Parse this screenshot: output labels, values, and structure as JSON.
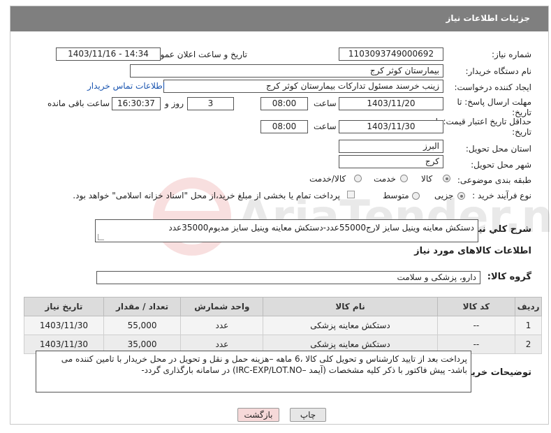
{
  "header": {
    "title": "جزئیات اطلاعات نیاز"
  },
  "labels": {
    "need_number": "شماره نیاز:",
    "announce_datetime": "تاریخ و ساعت اعلان عمومی:",
    "buyer_org": "نام دستگاه خریدار:",
    "requester": "ایجاد کننده درخواست:",
    "contact_link": "اطلاعات تماس خریدار",
    "reply_deadline_1": "مهلت ارسال پاسخ: تا",
    "reply_deadline_2": "تاریخ:",
    "time": "ساعت",
    "day_and": "روز و",
    "hours_remaining": "ساعت باقی مانده",
    "price_validity_1": "حداقل تاریخ اعتبار قیمت: تا",
    "price_validity_2": "تاریخ:",
    "delivery_province": "استان محل تحویل:",
    "delivery_city": "شهر محل تحویل:",
    "category": "طبقه بندی موضوعی:",
    "process_type": "نوع فرآیند خرید :",
    "general_desc": "شرح کلي نياز:",
    "goods_info": "اطلاعات کالاهای مورد نیاز",
    "goods_group": "گروه کالا:",
    "buyer_notes": "توضیحات خریدار:"
  },
  "values": {
    "need_number": "1103093749000692",
    "announce_datetime": "1403/11/16 - 14:34",
    "buyer_org": "بیمارستان کوثر کرج",
    "requester": "زینب خرسند مسئول تدارکات بیمارستان کوثر کرج",
    "reply_date": "1403/11/20",
    "reply_time": "08:00",
    "days": "3",
    "remaining_time": "16:30:37",
    "validity_date": "1403/11/30",
    "validity_time": "08:00",
    "province": "البرز",
    "city": "کرج",
    "general_desc": "دستکش معاینه وینیل سایز لارج55000عدد-دستکش معاینه وینیل سایز مدیوم35000عدد",
    "goods_group": "دارو، پزشکی و سلامت",
    "buyer_notes": "پرداخت بعد از تایید کارشناس و تحویل کلی کالا ،6 ماهه –هزینه حمل و نقل و تحویل در محل خریدار با تامین کننده می باشد- پیش فاکتور با ذکر کلیه مشخصات (آیمد –IRC-EXP/LOT.NO) در سامانه بارگذاری گردد-"
  },
  "category_options": {
    "goods": "کالا",
    "service": "خدمت",
    "goods_service": "کالا/خدمت",
    "selected": "کالا"
  },
  "process_options": {
    "small": "جزیی",
    "medium": "متوسط",
    "selected": "جزیی",
    "payment_note": "پرداخت تمام یا بخشی از مبلغ خرید،از محل \"اسناد خزانه اسلامی\" خواهد بود."
  },
  "table": {
    "headers": [
      "ردیف",
      "کد کالا",
      "نام کالا",
      "واحد شمارش",
      "تعداد / مقدار",
      "تاریخ نیاز"
    ],
    "rows": [
      [
        "1",
        "--",
        "دستکش معاینه پزشکی",
        "عدد",
        "55,000",
        "1403/11/30"
      ],
      [
        "2",
        "--",
        "دستکش معاینه پزشکی",
        "عدد",
        "35,000",
        "1403/11/30"
      ]
    ]
  },
  "buttons": {
    "print": "چاپ",
    "back": "بازگشت"
  },
  "watermark": {
    "text": "AriaTender.net"
  },
  "colors": {
    "header_bg": "#7f7f7f",
    "link": "#1a55b0",
    "back_btn_bg": "#f6d9d9",
    "print_btn_bg": "#e6e6e6"
  }
}
